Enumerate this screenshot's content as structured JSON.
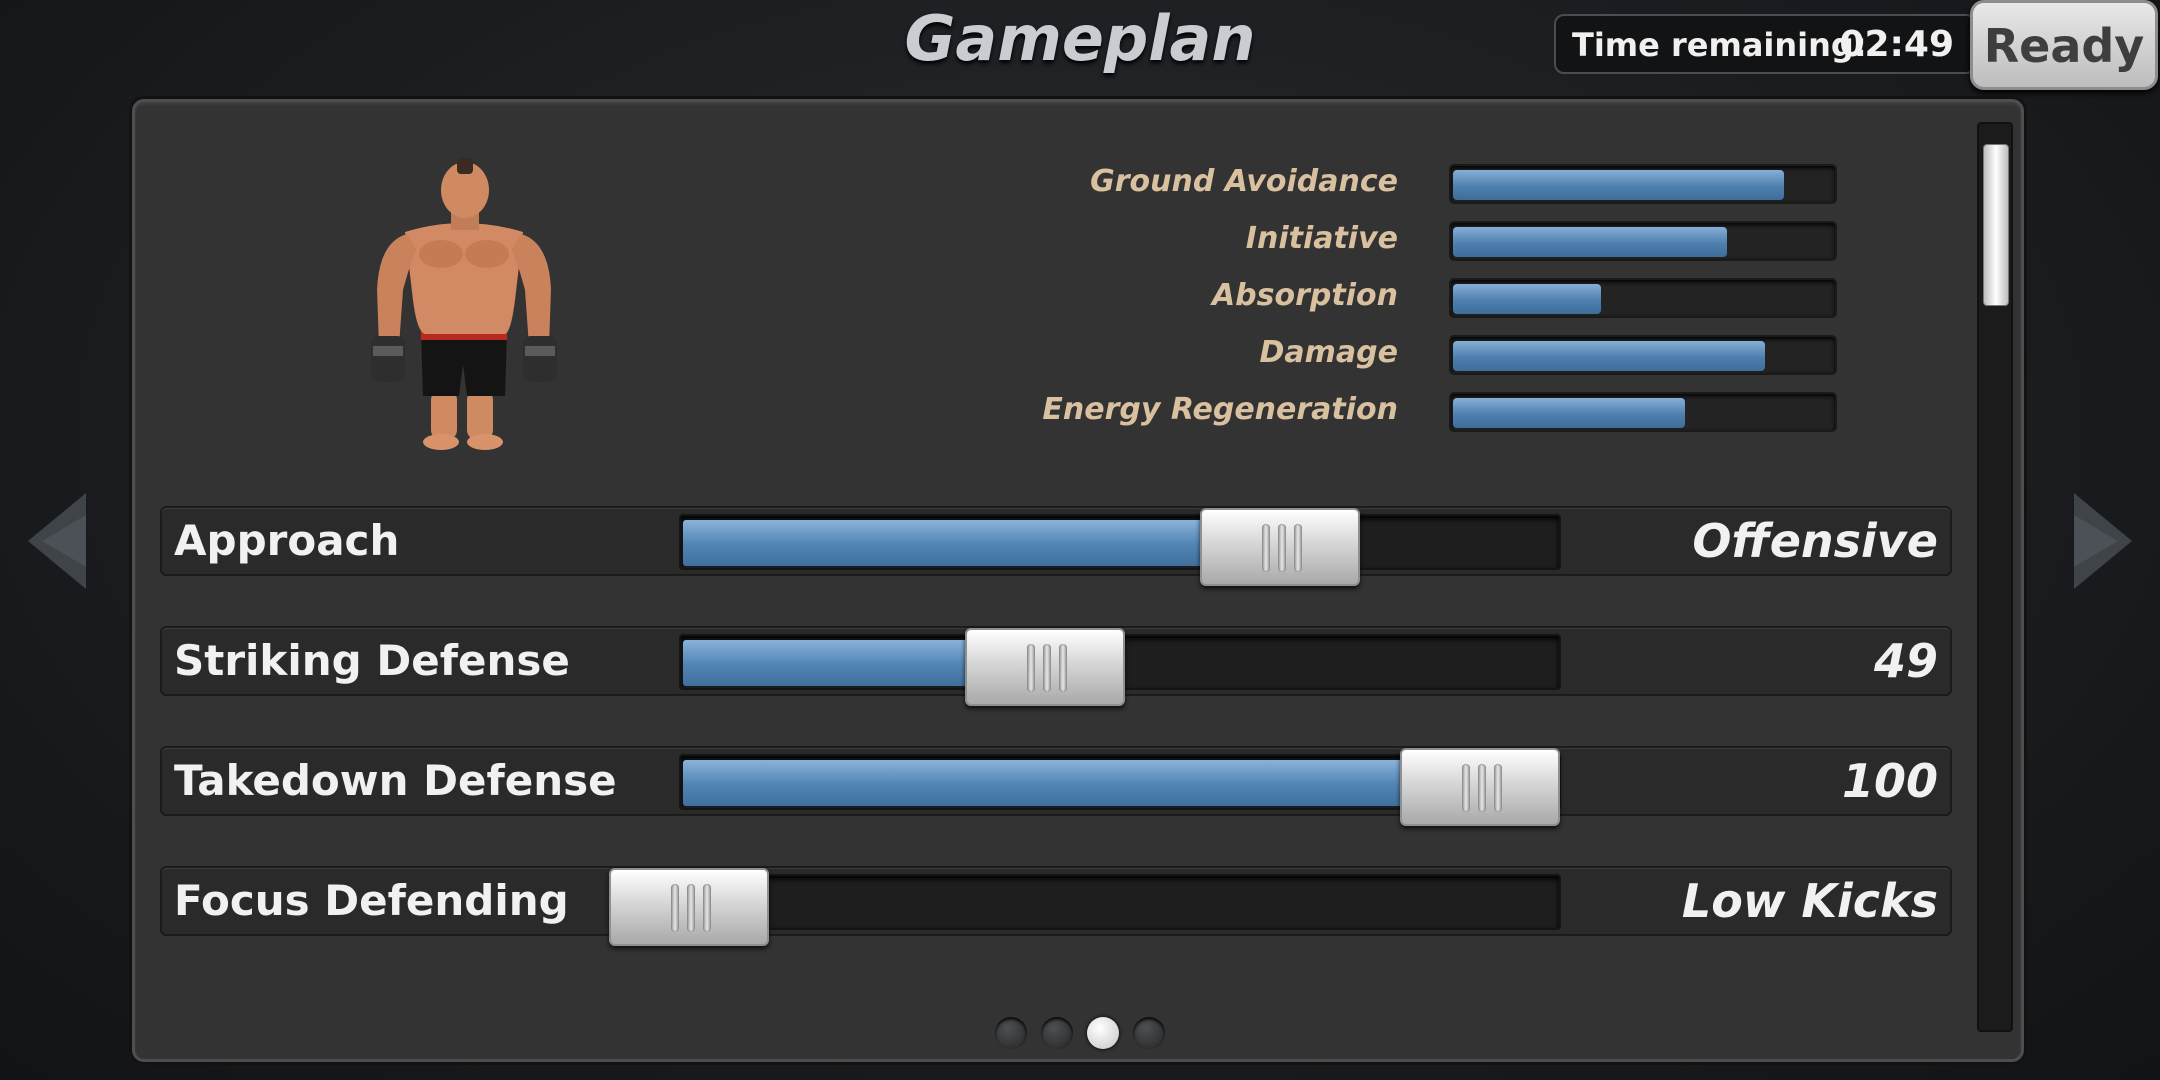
{
  "header": {
    "title": "Gameplan"
  },
  "timer": {
    "label": "Time remaining:",
    "value": "02:49"
  },
  "ready_button": {
    "label": "Ready"
  },
  "stats": [
    {
      "label": "Ground Avoidance",
      "fill": 0.87
    },
    {
      "label": "Initiative",
      "fill": 0.72
    },
    {
      "label": "Absorption",
      "fill": 0.39
    },
    {
      "label": "Damage",
      "fill": 0.82
    },
    {
      "label": "Energy Regeneration",
      "fill": 0.61
    }
  ],
  "sliders": [
    {
      "label": "Approach",
      "value": "Offensive",
      "level": 0.68
    },
    {
      "label": "Striking Defense",
      "value": "49",
      "level": 0.41
    },
    {
      "label": "Takedown Defense",
      "value": "100",
      "level": 0.91
    },
    {
      "label": "Focus Defending",
      "value": "Low Kicks",
      "level": 0.0
    }
  ],
  "pagination": {
    "pages": 4,
    "current": 3
  },
  "colors": {
    "stat_label": "#d9c1a0",
    "bar_fill": "#5587b6",
    "panel": "#333334"
  },
  "icons": {
    "left": "arrow-left-icon",
    "right": "arrow-right-icon"
  }
}
